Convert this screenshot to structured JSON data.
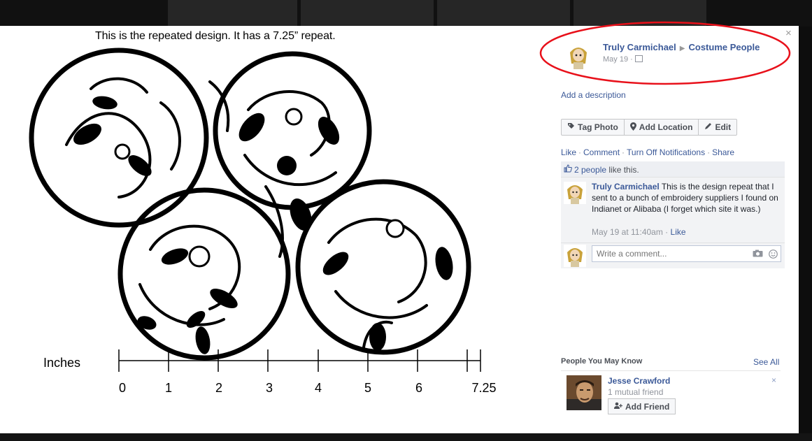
{
  "photo": {
    "caption": "This is the repeated design. It has a 7.25” repeat.",
    "ruler_label": "Inches",
    "ticks": [
      "0",
      "1",
      "2",
      "3",
      "4",
      "5",
      "6",
      "7.25"
    ]
  },
  "panel": {
    "close": "×",
    "owner_name": "Truly Carmichael",
    "separator": "▶",
    "group_name": "Costume People",
    "date": "May 19 ·",
    "add_description": "Add a description",
    "buttons": {
      "tag_photo": "Tag Photo",
      "add_location": "Add Location",
      "edit": "Edit"
    },
    "actions": [
      "Like",
      "Comment",
      "Turn Off Notifications",
      "Share"
    ],
    "action_sep": "·",
    "likes": {
      "count_text": "2 people",
      "suffix": " like this."
    },
    "comment": {
      "author": "Truly Carmichael",
      "text": " This is the design repeat that I sent to a bunch of embroidery suppliers I found on Indianet or Alibaba (I forget which site it was.)",
      "time": "May 19 at 11:40am",
      "meta_sep": " · ",
      "like": "Like"
    },
    "write_comment": {
      "placeholder": "Write a comment..."
    },
    "pymk": {
      "header": "People You May Know",
      "see_all": "See All",
      "name": "Jesse Crawford",
      "mutual": "1 mutual friend",
      "add_friend": "Add Friend",
      "dismiss": "×"
    }
  },
  "colors": {
    "link": "#3b5998",
    "annotation": "#e8101a"
  },
  "icons": [
    "close-icon",
    "audience-icon",
    "tag-icon",
    "location-pin-icon",
    "pencil-icon",
    "thumbs-up-icon",
    "camera-icon",
    "smiley-icon",
    "add-friend-icon"
  ]
}
